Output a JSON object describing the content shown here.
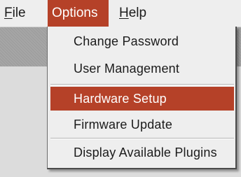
{
  "menubar": {
    "file": {
      "pre": "",
      "mnemonic": "F",
      "post": "ile"
    },
    "options": {
      "label": "Options"
    },
    "help": {
      "pre": "",
      "mnemonic": "H",
      "post": "elp"
    }
  },
  "dropdown": {
    "items": [
      {
        "label": "Change Password"
      },
      {
        "label": "User Management"
      },
      {
        "label": "Hardware Setup"
      },
      {
        "label": "Firmware Update"
      },
      {
        "label": "Display Available Plugins"
      }
    ],
    "highlighted_index": 2
  },
  "colors": {
    "accent": "#b54128",
    "menu_background": "#eeeeee",
    "backdrop": "#dcdcdc"
  }
}
